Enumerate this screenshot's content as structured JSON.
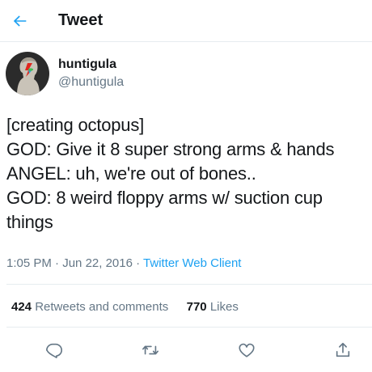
{
  "header": {
    "title": "Tweet",
    "back_icon": "arrow-left-icon",
    "accent_color": "#1da1f2"
  },
  "author": {
    "display_name": "huntigula",
    "handle": "@huntigula"
  },
  "tweet": {
    "lines": [
      "[creating octopus]",
      "GOD: Give it 8 super strong arms & hands",
      "ANGEL: uh, we're out of bones..",
      "GOD: 8 weird floppy arms w/ suction cup",
      "things"
    ],
    "time": "1:05 PM",
    "separator": "·",
    "date": "Jun 22, 2016",
    "client": "Twitter Web Client"
  },
  "stats": {
    "retweets_count": "424",
    "retweets_label": "Retweets and comments",
    "likes_count": "770",
    "likes_label": "Likes"
  },
  "actions": {
    "icons": [
      "reply-icon",
      "retweet-icon",
      "like-icon",
      "share-icon"
    ],
    "icon_color": "#657786"
  }
}
